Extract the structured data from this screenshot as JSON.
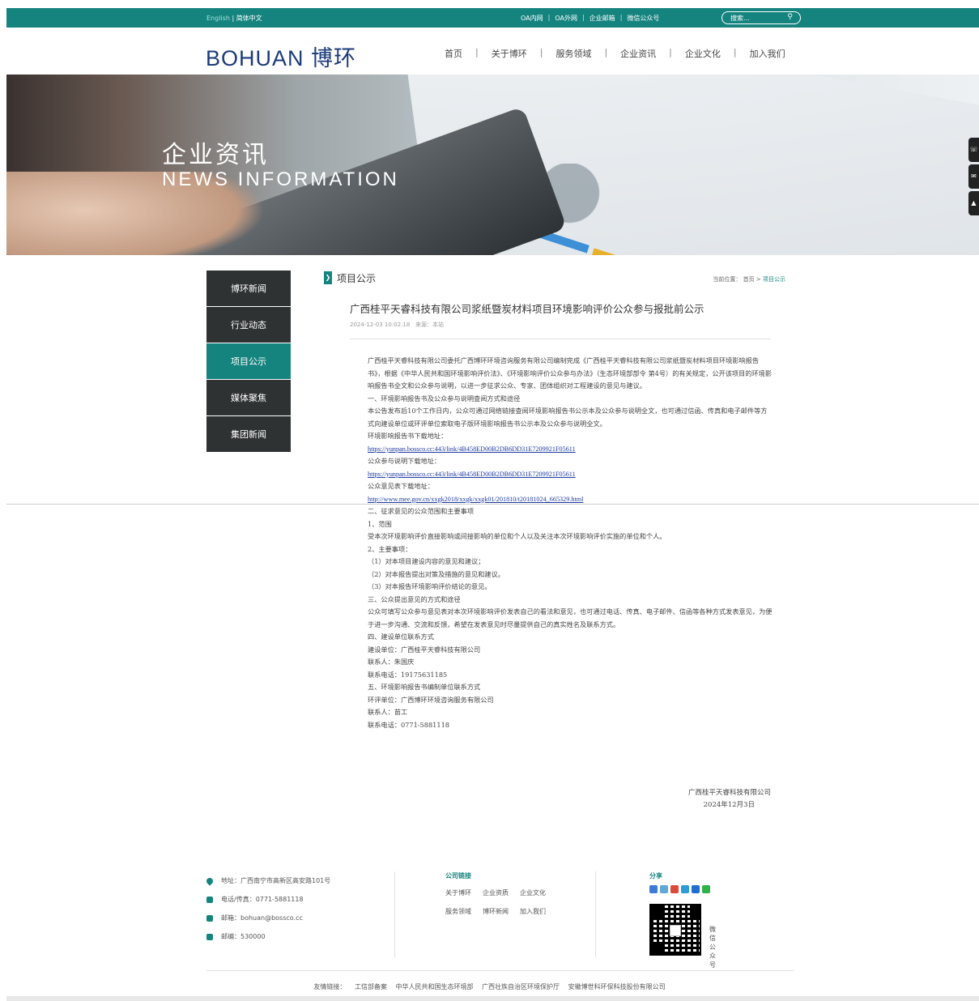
{
  "topbar": {
    "lang_en": "English",
    "lang_sep": "|",
    "lang_cn": "简体中文",
    "links": [
      "OA内网",
      "OA外网",
      "企业邮箱",
      "微信公众号"
    ],
    "search_placeholder": "搜索..."
  },
  "header": {
    "logo_latin": "BOHUAN",
    "logo_cn": "博环",
    "nav": [
      "首页",
      "关于博环",
      "服务领域",
      "企业资讯",
      "企业文化",
      "加入我们"
    ]
  },
  "banner": {
    "title_cn": "企业资讯",
    "title_en": "NEWS INFORMATION"
  },
  "sidebar": {
    "items": [
      {
        "label": "博环新闻",
        "active": false
      },
      {
        "label": "行业动态",
        "active": false
      },
      {
        "label": "项目公示",
        "active": true
      },
      {
        "label": "媒体聚焦",
        "active": false
      },
      {
        "label": "集团新闻",
        "active": false
      }
    ]
  },
  "section": {
    "title": "项目公示",
    "breadcrumb_prefix": "当前位置：",
    "breadcrumb_home": "首页",
    "breadcrumb_sep": ">",
    "breadcrumb_current": "项目公示"
  },
  "article": {
    "title": "广西桂平天睿科技有限公司浆纸暨炭材料项目环境影响评价公众参与报批前公示",
    "date": "2024-12-03 10:02:18",
    "source_label": "来源：",
    "source": "本站",
    "paragraph_1": "广西桂平天睿科技有限公司委托广西博环环境咨询服务有限公司编制完成《广西桂平天睿科技有限公司浆纸暨炭材料项目环境影响报告书》，根据《中华人民共和国环境影响评价法》、《环境影响评价公众参与办法》（生态环境部部令 第4号）的有关规定，公开该项目的环境影响报告书全文和公众参与说明，以进一步征求公众、专家、团体组织对工程建设的意见与建议。",
    "heading_1": "一、环境影响报告书及公众参与说明查阅方式和途径",
    "paragraph_2": "本公告发布后10个工作日内，公众可通过网络链接查阅环境影响报告书公示本及公众参与说明全文，也可通过信函、传真和电子邮件等方式向建设单位或环评单位索取电子版环境影响报告书公示本及公众参与说明全文。",
    "link_label_1": "环境影响报告书下载地址：",
    "link_1": "https://yunpan.bossco.cc:443/link/4B458ED00B2DB6DD31E7209921F05611",
    "link_label_2": "公众参与说明下载地址：",
    "link_2": "https://yunpan.bossco.cc:443/link/4B458ED00B2DB6DD31E7209921F05611",
    "link_label_3": "公众意见表下载地址：",
    "link_3": "http://www.mee.gov.cn/xxgk2018/xxgk/xxgk01/201810/t20181024_665329.html",
    "heading_2": "二、征求意见的公众范围和主要事项",
    "sub_1": "1、范围",
    "scope_text": "受本次环境影响评价直接影响或间接影响的单位和个人以及关注本次环境影响评价实施的单位和个人。",
    "sub_2": "2、主要事项：",
    "item_1": "（1）对本项目建设内容的意见和建议；",
    "item_2": "（2）对本报告提出对策及措施的意见和建议。",
    "item_3": "（3）对本报告环境影响评价结论的意见。",
    "heading_3": "三、公众提出意见的方式和途径",
    "paragraph_3": "公众可填写公众参与意见表对本次环境影响评价发表自己的看法和意见，也可通过电话、传真、电子邮件、信函等各种方式发表意见，为便于进一步沟通、交流和反馈，希望在发表意见时尽量提供自己的真实姓名及联系方式。",
    "heading_4": "四、建设单位联系方式",
    "builder": "建设单位：广西桂平天睿科技有限公司",
    "builder_contact": "联系人：朱国庆",
    "builder_phone": "联系电话：19175631185",
    "heading_5": "五、环境影响报告书编制单位联系方式",
    "eia_unit": "环评单位：广西博环环境咨询服务有限公司",
    "eia_contact": "联系人：苗工",
    "eia_phone": "联系电话：0771-5881118",
    "sign_company": "广西桂平天睿科技有限公司",
    "sign_date": "2024年12月3日"
  },
  "footer": {
    "address": "地址：广西南宁市高新区高安路101号",
    "phone": "电话/传真：0771-5881118",
    "email": "邮箱：bohuan@bossco.cc",
    "postcode": "邮编：530000",
    "links_title": "公司链接",
    "links_row1": [
      "关于博环",
      "企业资质",
      "企业文化"
    ],
    "links_row2": [
      "服务领域",
      "博环新闻",
      "加入我们"
    ],
    "share_title": "分享",
    "qr_label": "微信公众号",
    "friend_label": "友情链接：",
    "friend_links": [
      "工信部备案",
      "中华人民共和国生态环境部",
      "广西壮族自治区环境保护厅",
      "安徽博世科环保科技股份有限公司"
    ]
  },
  "colors": {
    "brand": "#15847f",
    "dark_menu": "#2f3233",
    "link": "#1e3aa0"
  }
}
